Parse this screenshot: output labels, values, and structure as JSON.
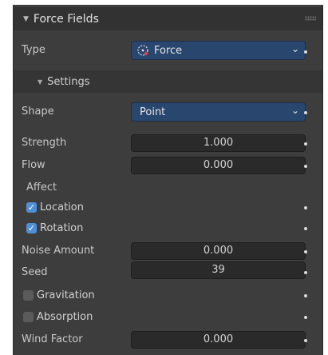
{
  "panel": {
    "title": "Force Fields"
  },
  "type_row": {
    "label": "Type",
    "value": "Force",
    "icon": "force-field-icon"
  },
  "settings": {
    "title": "Settings"
  },
  "shape_row": {
    "label": "Shape",
    "value": "Point"
  },
  "strength": {
    "label": "Strength",
    "value": "1.000"
  },
  "flow": {
    "label": "Flow",
    "value": "0.000"
  },
  "affect": {
    "label": "Affect",
    "location": {
      "label": "Location",
      "checked": true
    },
    "rotation": {
      "label": "Rotation",
      "checked": true
    }
  },
  "noise": {
    "label": "Noise Amount",
    "value": "0.000"
  },
  "seed": {
    "label": "Seed",
    "value": "39"
  },
  "gravitation": {
    "label": "Gravitation",
    "checked": false
  },
  "absorption": {
    "label": "Absorption",
    "checked": false
  },
  "wind": {
    "label": "Wind Factor",
    "value": "0.000"
  },
  "colors": {
    "accent": "#4f8fd6",
    "dropdown": "#28466e",
    "panel": "#3d3d3d",
    "header": "#323232"
  }
}
